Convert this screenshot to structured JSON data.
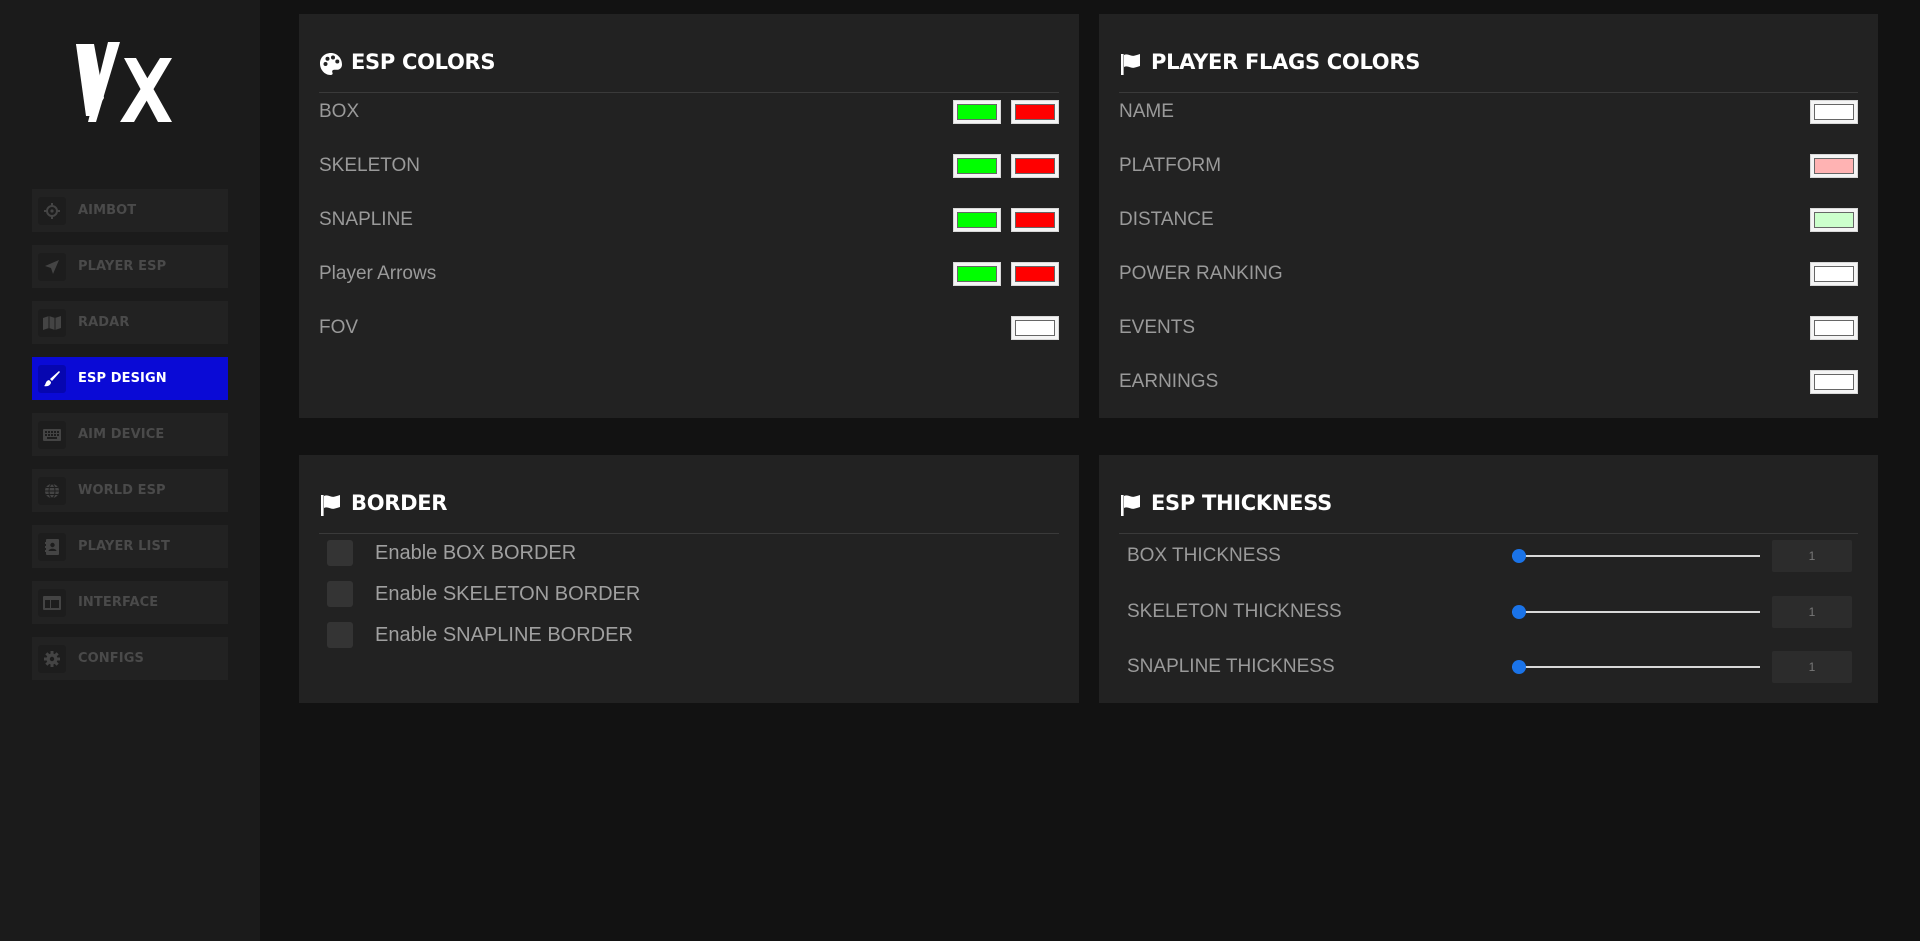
{
  "logo": {
    "text": "VX"
  },
  "sidebar": {
    "items": [
      {
        "label": "AIMBOT",
        "icon": "crosshair-icon",
        "active": false
      },
      {
        "label": "PLAYER ESP",
        "icon": "location-arrow-icon",
        "active": false
      },
      {
        "label": "RADAR",
        "icon": "map-icon",
        "active": false
      },
      {
        "label": "ESP DESIGN",
        "icon": "paintbrush-icon",
        "active": true
      },
      {
        "label": "AIM DEVICE",
        "icon": "keyboard-icon",
        "active": false
      },
      {
        "label": "WORLD ESP",
        "icon": "globe-icon",
        "active": false
      },
      {
        "label": "PLAYER LIST",
        "icon": "address-book-icon",
        "active": false
      },
      {
        "label": "INTERFACE",
        "icon": "window-icon",
        "active": false
      },
      {
        "label": "CONFIGS",
        "icon": "gear-icon",
        "active": false
      }
    ],
    "active_color": "#0a0ad6"
  },
  "esp_colors": {
    "title": "ESP COLORS",
    "icon": "palette-icon",
    "rows": [
      {
        "label": "BOX",
        "colors": [
          "#00ff00",
          "#ff0000"
        ]
      },
      {
        "label": "SKELETON",
        "colors": [
          "#00ff00",
          "#ff0000"
        ]
      },
      {
        "label": "SNAPLINE",
        "colors": [
          "#00ff00",
          "#ff0000"
        ]
      },
      {
        "label": "Player Arrows",
        "colors": [
          "#00ff00",
          "#ff0000"
        ]
      },
      {
        "label": "FOV",
        "colors": [
          "#ffffff"
        ]
      }
    ]
  },
  "player_flags_colors": {
    "title": "PLAYER FLAGS COLORS",
    "icon": "flag-icon",
    "rows": [
      {
        "label": "NAME",
        "colors": [
          "#ffffff"
        ]
      },
      {
        "label": "PLATFORM",
        "colors": [
          "#ffb3b3"
        ]
      },
      {
        "label": "DISTANCE",
        "colors": [
          "#ccffcc"
        ]
      },
      {
        "label": "POWER RANKING",
        "colors": [
          "#ffffff"
        ]
      },
      {
        "label": "EVENTS",
        "colors": [
          "#ffffff"
        ]
      },
      {
        "label": "EARNINGS",
        "colors": [
          "#ffffff"
        ]
      }
    ]
  },
  "border": {
    "title": "BORDER",
    "icon": "flag-icon",
    "options": [
      {
        "label": "Enable BOX BORDER",
        "checked": false
      },
      {
        "label": "Enable SKELETON BORDER",
        "checked": false
      },
      {
        "label": "Enable SNAPLINE BORDER",
        "checked": false
      }
    ]
  },
  "esp_thickness": {
    "title": "ESP THICKNESS",
    "icon": "flag-icon",
    "sliders": [
      {
        "label": "BOX THICKNESS",
        "value": "1"
      },
      {
        "label": "SKELETON THICKNESS",
        "value": "1"
      },
      {
        "label": "SNAPLINE THICKNESS",
        "value": "1"
      }
    ]
  }
}
